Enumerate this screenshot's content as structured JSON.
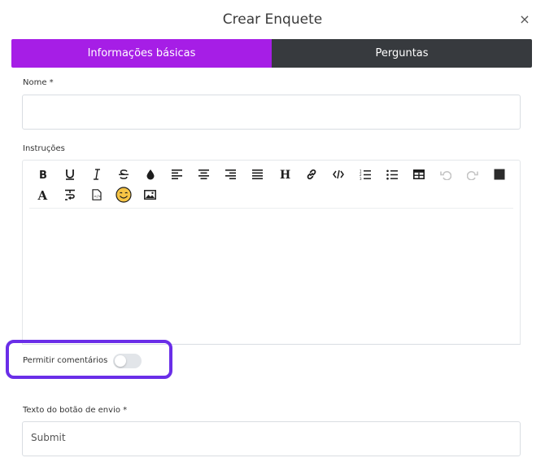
{
  "modal": {
    "title": "Crear Enquete",
    "close_symbol": "×"
  },
  "tabs": [
    {
      "label": "Informações básicas",
      "active": true
    },
    {
      "label": "Perguntas",
      "active": false
    }
  ],
  "colors": {
    "accent": "#a61ee6",
    "tab_inactive": "#373a3e",
    "highlight": "#6a2ee8"
  },
  "form": {
    "name": {
      "label": "Nome *",
      "value": ""
    },
    "instructions": {
      "label": "Instruções",
      "content": ""
    },
    "allow_comments": {
      "label": "Permitir comentários",
      "enabled": false
    },
    "submit_text": {
      "label": "Texto do botão de envio *",
      "placeholder": "Submit"
    }
  },
  "toolbar": {
    "row1": [
      "bold-icon",
      "underline-icon",
      "italic-icon",
      "strikethrough-icon",
      "text-color-icon",
      "align-left-icon",
      "align-center-icon",
      "align-right-icon",
      "align-justify-icon",
      "heading-icon",
      "link-icon",
      "code-icon",
      "ordered-list-icon",
      "unordered-list-icon",
      "table-icon",
      "undo-icon",
      "redo-icon",
      "background-color-icon"
    ],
    "row2": [
      "font-icon",
      "clear-format-icon",
      "html-file-icon",
      "emoji-icon",
      "image-icon"
    ]
  }
}
